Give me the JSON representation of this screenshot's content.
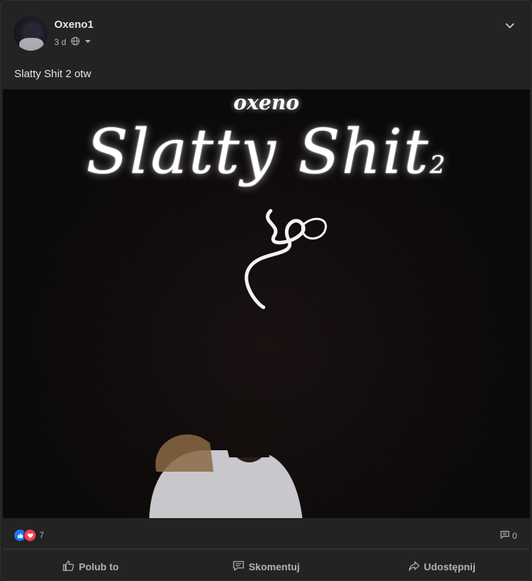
{
  "post": {
    "author": "Oxeno1",
    "time": "3 d",
    "text": "Slatty Shit 2 otw"
  },
  "media": {
    "artist_text": "oxeno",
    "title_main": "Slatty Shit",
    "title_number": "2"
  },
  "reactions": {
    "count": "7",
    "comments_count": "0"
  },
  "actions": {
    "like_label": "Polub to",
    "comment_label": "Skomentuj",
    "share_label": "Udostępnij"
  },
  "colors": {
    "card_bg": "#232323",
    "like_blue": "#1877f2",
    "love_red": "#f33e58",
    "text_muted": "#b0b3b8"
  }
}
